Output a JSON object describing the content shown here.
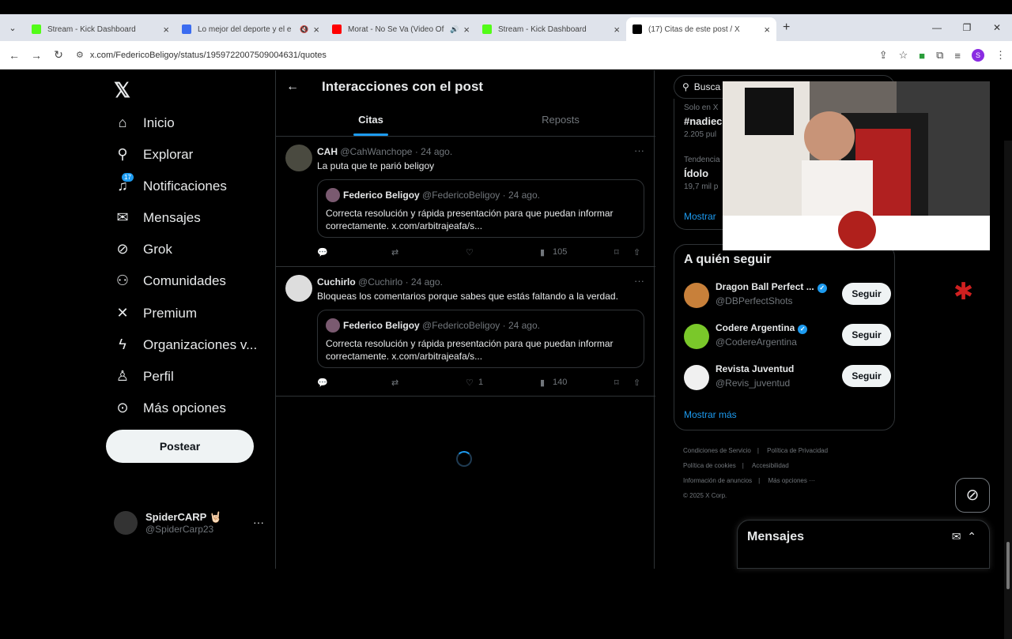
{
  "browser": {
    "tabs": [
      {
        "title": "Stream - Kick Dashboard",
        "fav_color": "#53fc18"
      },
      {
        "title": "Lo mejor del deporte y el e",
        "fav_color": "#3b6cf0"
      },
      {
        "title": "Morat - No Se Va (Video Of",
        "fav_color": "#ff0000"
      },
      {
        "title": "Stream - Kick Dashboard",
        "fav_color": "#53fc18"
      },
      {
        "title": "(17) Citas de este post / X",
        "fav_color": "#000000"
      }
    ],
    "url": "x.com/FedericoBeligoy/status/1959722007509004631/quotes"
  },
  "nav": {
    "items": [
      {
        "label": "Inicio",
        "icon": "home-icon"
      },
      {
        "label": "Explorar",
        "icon": "search-icon"
      },
      {
        "label": "Notificaciones",
        "icon": "bell-icon",
        "badge": "17"
      },
      {
        "label": "Mensajes",
        "icon": "mail-icon"
      },
      {
        "label": "Grok",
        "icon": "grok-icon"
      },
      {
        "label": "Comunidades",
        "icon": "people-icon"
      },
      {
        "label": "Premium",
        "icon": "x-icon"
      },
      {
        "label": "Organizaciones v...",
        "icon": "bolt-icon"
      },
      {
        "label": "Perfil",
        "icon": "person-icon"
      },
      {
        "label": "Más opciones",
        "icon": "more-icon"
      }
    ],
    "post_button": "Postear",
    "me": {
      "name": "SpiderCARP 🤘🏻",
      "handle": "@SpiderCarp23"
    }
  },
  "main": {
    "title": "Interacciones con el post",
    "tabs": [
      "Citas",
      "Reposts"
    ],
    "posts": [
      {
        "name": "CAH",
        "handle": "@CahWanchope",
        "date": "· 24 ago.",
        "text": "La puta que te parió beligoy",
        "quote": {
          "name": "Federico Beligoy",
          "handle": "@FedericoBeligoy",
          "date": "· 24 ago.",
          "text": "Correcta resolución y rápida presentación para que puedan informar correctamente. x.com/arbitrajeafa/s..."
        },
        "likes": "",
        "views": "105",
        "avatar_color": "#4a4a40"
      },
      {
        "name": "Cuchirlo",
        "handle": "@Cuchirlo",
        "date": "· 24 ago.",
        "text": "Bloqueas los comentarios porque sabes que estás faltando a la verdad.",
        "quote": {
          "name": "Federico Beligoy",
          "handle": "@FedericoBeligoy",
          "date": "· 24 ago.",
          "text": "Correcta resolución y rápida presentación para que puedan informar correctamente. x.com/arbitrajeafa/s..."
        },
        "likes": "1",
        "views": "140",
        "avatar_color": "#dddddd"
      }
    ]
  },
  "right": {
    "search_placeholder": "Busca",
    "trends": [
      {
        "context": "Solo en X",
        "name": "#nadiec",
        "count": "2.205 pul"
      },
      {
        "context": "Tendencia",
        "name": "Ídolo",
        "count": "19,7 mil p"
      }
    ],
    "trends_more": "Mostrar",
    "follow_title": "A quién seguir",
    "accounts": [
      {
        "name": "Dragon Ball Perfect ...",
        "handle": "@DBPerfectShots",
        "color": "#c8803a",
        "verified": true
      },
      {
        "name": "Codere Argentina",
        "handle": "@CodereArgentina",
        "color": "#7ac82a",
        "verified": true
      },
      {
        "name": "Revista Juventud",
        "handle": "@Revis_juventud",
        "color": "#f0f0f0",
        "verified": false
      }
    ],
    "follow_button": "Seguir",
    "follow_more": "Mostrar más",
    "footer": [
      "Condiciones de Servicio",
      "Política de Privacidad",
      "Política de cookies",
      "Accesibilidad",
      "Información de anuncios",
      "Más opciones ···",
      "© 2025 X Corp."
    ]
  },
  "dock": {
    "title": "Mensajes"
  },
  "colors": {
    "accent": "#1d9bf0",
    "border": "#2f3336",
    "muted": "#71767b"
  }
}
